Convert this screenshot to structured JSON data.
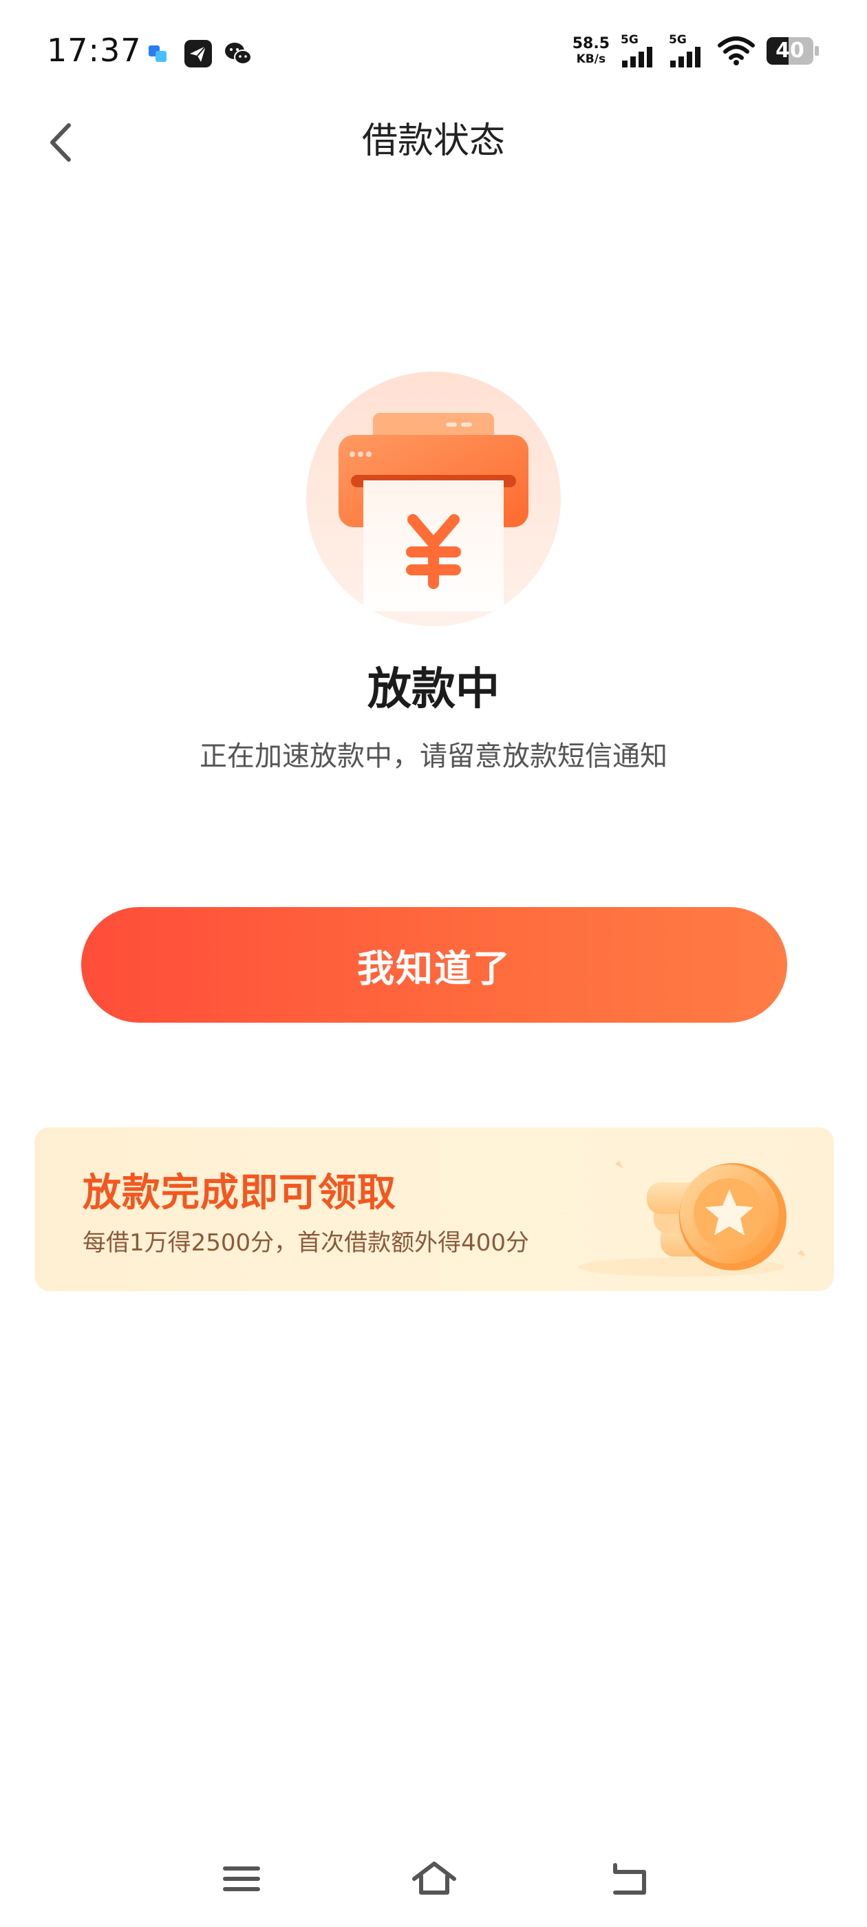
{
  "status_bar": {
    "time": "17:37",
    "net_speed_value": "58.5",
    "net_speed_unit": "KB/s",
    "signal1_label": "5G",
    "signal2_label": "5G",
    "battery": "40"
  },
  "header": {
    "title": "借款状态",
    "back_icon": "chevron-left-icon"
  },
  "status": {
    "title": "放款中",
    "description": "正在加速放款中，请留意放款短信通知",
    "illustration_icon": "yuan-printer-icon"
  },
  "actions": {
    "confirm_label": "我知道了"
  },
  "reward_banner": {
    "title": "放款完成即可领取",
    "subtitle": "每借1万得2500分，首次借款额外得400分",
    "icon": "star-coins-icon"
  },
  "bottom_nav": {
    "menu_icon": "menu-icon",
    "home_icon": "home-icon",
    "back_icon": "return-icon"
  },
  "colors": {
    "accent": "#ff5a3c",
    "reward_title": "#f3571f",
    "reward_bg": "#fff1d6"
  }
}
